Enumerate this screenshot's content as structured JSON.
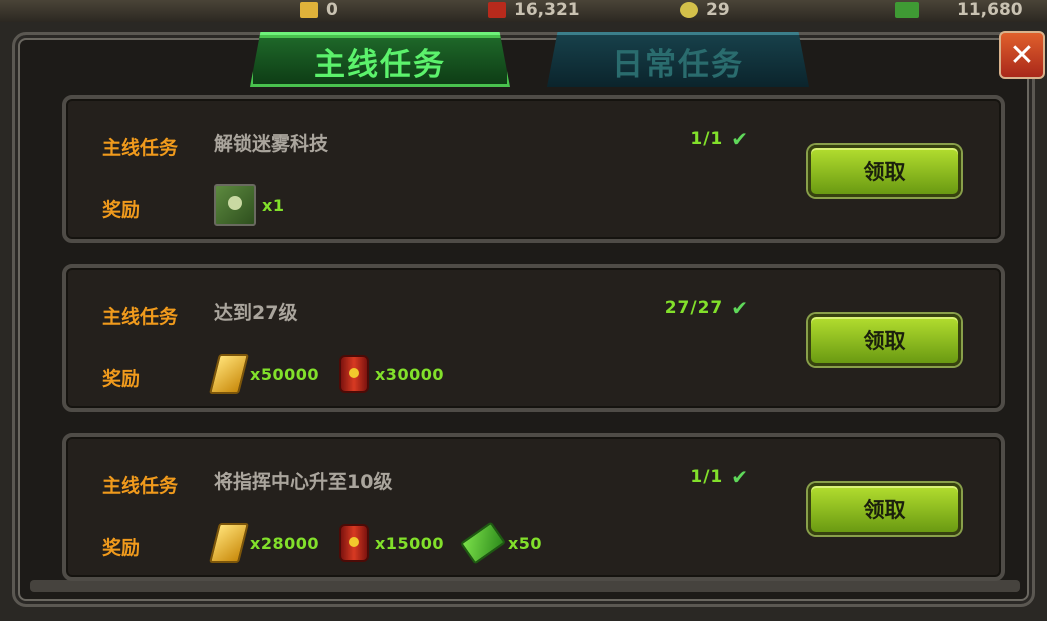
{
  "resource_bar": {
    "gold": "0",
    "oil": "16,321",
    "energy": "29",
    "cash": "11,680"
  },
  "tabs": [
    {
      "label": "主线任务",
      "active": true
    },
    {
      "label": "日常任务",
      "active": false
    }
  ],
  "close_label": "✕",
  "tasks": [
    {
      "type_label": "主线任务",
      "description": "解锁迷雾科技",
      "progress": "1/1",
      "reward_label": "奖励",
      "claim_label": "领取",
      "rewards": [
        {
          "icon": "tech-book-icon",
          "amount": "x1"
        }
      ]
    },
    {
      "type_label": "主线任务",
      "description": "达到27级",
      "progress": "27/27",
      "reward_label": "奖励",
      "claim_label": "领取",
      "rewards": [
        {
          "icon": "gold-bar-icon",
          "amount": "x50000"
        },
        {
          "icon": "oil-barrel-icon",
          "amount": "x30000"
        }
      ]
    },
    {
      "type_label": "主线任务",
      "description": "将指挥中心升至10级",
      "progress": "1/1",
      "reward_label": "奖励",
      "claim_label": "领取",
      "rewards": [
        {
          "icon": "gold-bar-icon",
          "amount": "x28000"
        },
        {
          "icon": "oil-barrel-icon",
          "amount": "x15000"
        },
        {
          "icon": "cash-icon",
          "amount": "x50"
        }
      ]
    }
  ],
  "colors": {
    "active_tab": "#5cf26c",
    "label_orange": "#f09a1c",
    "amount_green": "#82e02b",
    "button_green": "#8fbe1e"
  }
}
